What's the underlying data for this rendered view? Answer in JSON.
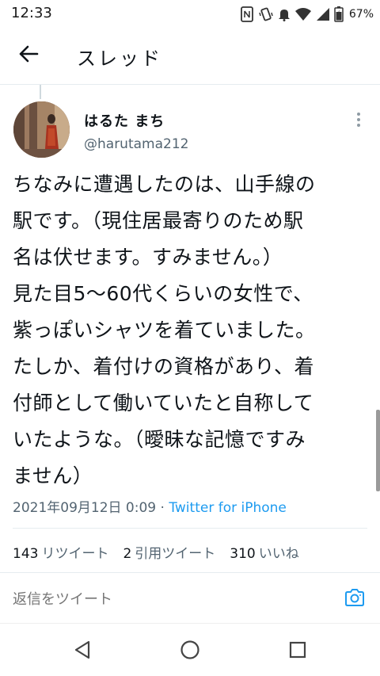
{
  "status_bar": {
    "time": "12:33",
    "battery_percent": "67%",
    "icons": [
      "nfc-icon",
      "vibrate-icon",
      "alarm-icon",
      "wifi-icon",
      "signal-icon",
      "battery-icon"
    ]
  },
  "header": {
    "title": "スレッド",
    "back_icon": "arrow-left-icon"
  },
  "tweet": {
    "author_name": "はるた まち",
    "author_handle": "@harutama212",
    "text_lines": [
      "ちなみに遭遇したのは、山手線の",
      "駅です。（現住居最寄りのため駅",
      "名は伏せます。すみません。）",
      "見た目5〜60代くらいの女性で、",
      "紫っぽいシャツを着ていました。",
      "たしか、着付けの資格があり、着",
      "付師として働いていたと自称して",
      "いたような。（曖昧な記憶ですみ",
      "ません）"
    ],
    "date": "2021年09月12日 0:09",
    "separator": "·",
    "source": "Twitter for iPhone",
    "stats": {
      "retweets_count": "143",
      "retweets_label": "リツイート",
      "quotes_count": "2",
      "quotes_label": "引用ツイート",
      "likes_count": "310",
      "likes_label": "いいね"
    }
  },
  "reply": {
    "placeholder": "返信をツイート",
    "camera_icon": "camera-icon"
  },
  "nav": {
    "back_icon": "triangle-back-icon",
    "home_icon": "circle-home-icon",
    "recents_icon": "square-recents-icon"
  },
  "colors": {
    "accent": "#1d9bf0",
    "text_primary": "#0f1419",
    "text_secondary": "#536471",
    "divider": "#e6ecf0"
  }
}
